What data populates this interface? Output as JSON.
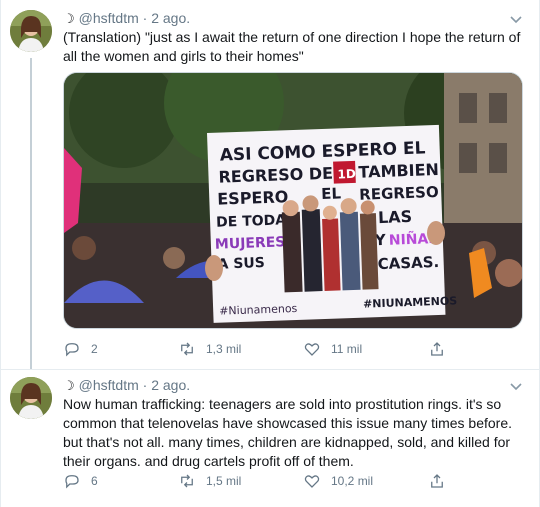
{
  "tweets": [
    {
      "handle": "@hsftdtm",
      "moon": "☽",
      "time": "· 2 ago.",
      "text": "(Translation) \"just as I await the return of one direction I hope the return of all the women and girls to their homes\"",
      "media": {
        "sign_lines": [
          "ASI COMO ESPERO EL",
          "REGRESO DE",
          "1D",
          "TAMBIEN",
          "ESPERO",
          "EL",
          "REGRESO",
          "DE TODAS",
          "LAS",
          "MUJERES",
          "Y",
          "NIÑAS",
          "A SUS",
          "CASAS.",
          "#Niunamenos",
          "#NIUNAMENOS"
        ]
      },
      "reply_count": "2",
      "retweet_count": "1,3 mil",
      "like_count": "11 mil"
    },
    {
      "handle": "@hsftdtm",
      "moon": "☽",
      "time": "· 2 ago.",
      "text": "Now human trafficking: teenagers are sold into prostitution rings. it's so common that telenovelas have showcased this issue many times before. but that's not all. many times, children are kidnapped, sold, and killed for their organs. and drug cartels profit off of them.",
      "reply_count": "6",
      "retweet_count": "1,5 mil",
      "like_count": "10,2 mil"
    }
  ],
  "colors": {
    "secondary_text": "#657786",
    "primary_text": "#14171a",
    "border": "#e6ecf0"
  },
  "icons": [
    "moon-icon",
    "chevron-down-icon",
    "reply-icon",
    "retweet-icon",
    "like-icon",
    "share-icon"
  ]
}
